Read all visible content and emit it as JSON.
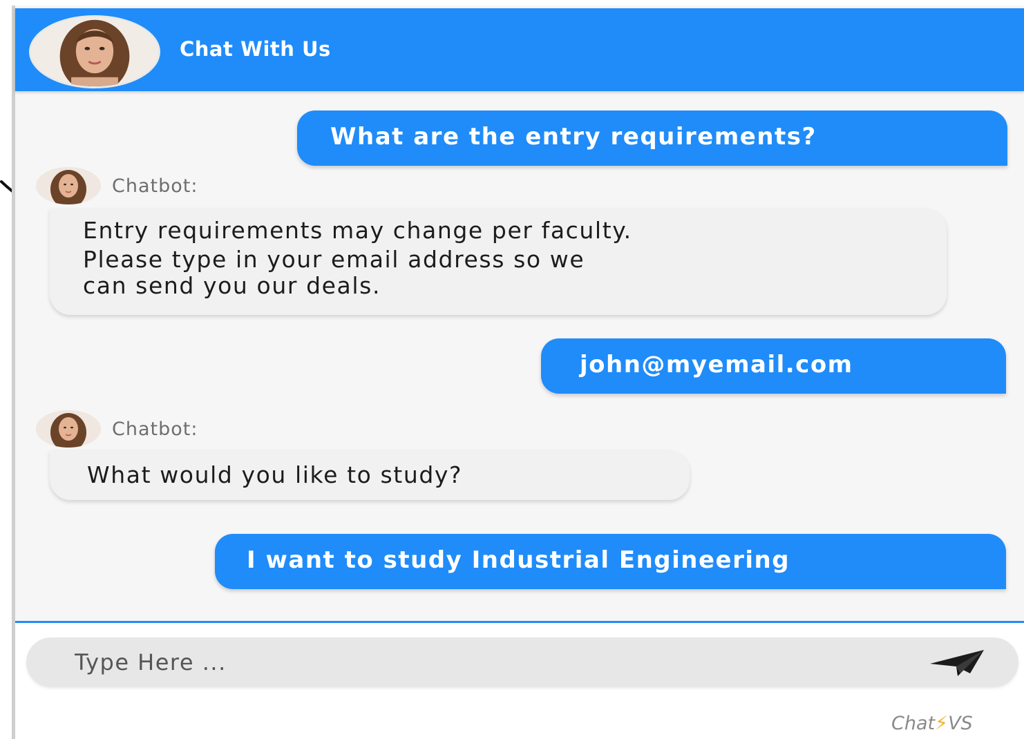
{
  "header": {
    "title": "Chat With Us"
  },
  "messages": [
    {
      "sender": "user",
      "text": "What are the entry requirements?"
    },
    {
      "sender": "bot",
      "label": "Chatbot:",
      "lines": [
        "Entry requirements may change per faculty.",
        "Please type in your email address so we",
        "can send you our deals."
      ]
    },
    {
      "sender": "user",
      "text": "john@myemail.com"
    },
    {
      "sender": "bot",
      "label": "Chatbot:",
      "lines": [
        "What would you like to study?"
      ]
    },
    {
      "sender": "user",
      "text": "I want to study Industrial Engineering"
    }
  ],
  "composer": {
    "placeholder": "Type Here ..."
  },
  "branding": {
    "prefix": "Chat",
    "bolt": "⚡",
    "suffix": "VS"
  },
  "colors": {
    "accent": "#1f8cf9",
    "bot_bubble": "#f1f1f1",
    "background": "#f6f6f6"
  },
  "icons": {
    "header_avatar": "agent-portrait-icon",
    "bot_avatar": "bot-portrait-icon",
    "send": "paper-plane-icon"
  }
}
